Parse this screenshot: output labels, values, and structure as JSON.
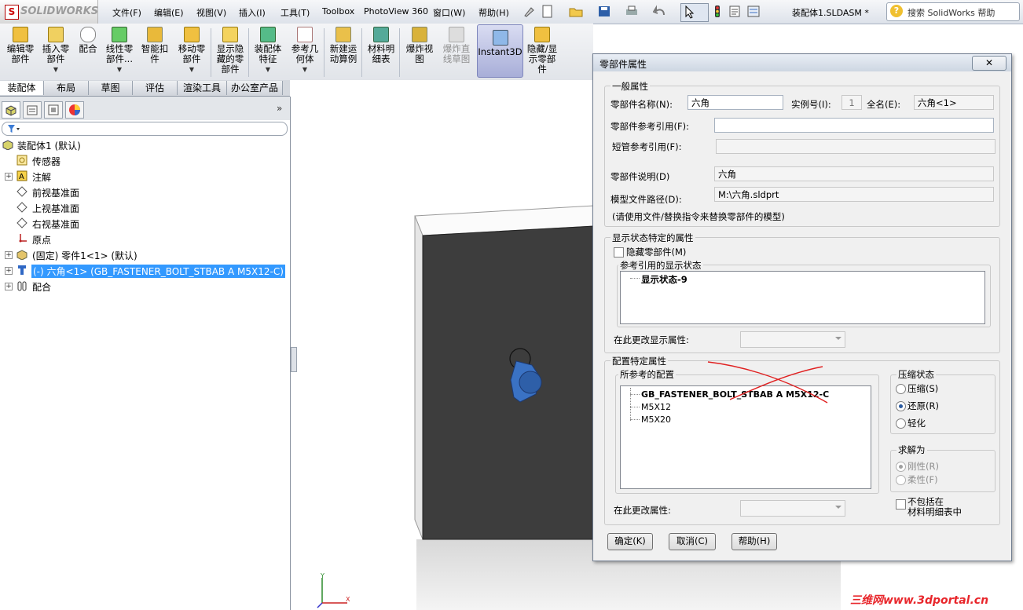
{
  "app": {
    "logo_text": "SOLIDWORKS",
    "document_title": "装配体1.SLDASM *"
  },
  "menu": [
    "文件(F)",
    "编辑(E)",
    "视图(V)",
    "插入(I)",
    "工具(T)",
    "Toolbox",
    "PhotoView 360",
    "窗口(W)",
    "帮助(H)"
  ],
  "search": {
    "placeholder": "搜索 SolidWorks 帮助"
  },
  "commands": [
    {
      "label": "编辑零\n部件"
    },
    {
      "label": "插入零\n部件"
    },
    {
      "label": "配合"
    },
    {
      "label": "线性零\n部件..."
    },
    {
      "label": "智能扣\n件"
    },
    {
      "label": "移动零\n部件"
    },
    {
      "label": "显示隐\n藏的零\n部件"
    },
    {
      "label": "装配体\n特征"
    },
    {
      "label": "参考几\n何体"
    },
    {
      "label": "新建运\n动算例"
    },
    {
      "label": "材料明\n细表"
    },
    {
      "label": "爆炸视\n图"
    },
    {
      "label": "爆炸直\n线草图"
    },
    {
      "label": "Instant3D"
    },
    {
      "label": "隐藏/显\n示零部\n件"
    }
  ],
  "tabs": [
    "装配体",
    "布局",
    "草图",
    "评估",
    "渲染工具",
    "办公室产品"
  ],
  "tree": {
    "root": "装配体1  (默认)",
    "items": [
      "传感器",
      "注解",
      "前视基准面",
      "上视基准面",
      "右视基准面",
      "原点",
      "(固定) 零件1<1> (默认)",
      "(-) 六角<1> (GB_FASTENER_BOLT_STBAB A M5X12-C)",
      "配合"
    ]
  },
  "dialog": {
    "title": "零部件属性",
    "close": "✕",
    "general": {
      "group": "一般属性",
      "name_label": "零部件名称(N):",
      "name_value": "六角",
      "instance_label": "实例号(I):",
      "instance_value": "1",
      "fullname_label": "全名(E):",
      "fullname_value": "六角<1>",
      "ref_label": "零部件参考引用(F):",
      "ref_value": "",
      "pipe_label": "短管参考引用(F):",
      "pipe_value": "",
      "desc_label": "零部件说明(D)",
      "desc_value": "六角",
      "path_label": "模型文件路径(D):",
      "path_value": "M:\\六角.sldprt",
      "note": "(请使用文件/替换指令来替换零部件的模型)"
    },
    "display": {
      "group": "显示状态特定的属性",
      "hide_label": "隐藏零部件(M)",
      "refstates_label": "参考引用的显示状态",
      "states": [
        "显示状态-9"
      ],
      "change_label": "在此更改显示属性:"
    },
    "config": {
      "group": "配置特定属性",
      "ref_label": "所参考的配置",
      "configs": [
        "GB_FASTENER_BOLT_STBAB A M5X12-C",
        "M5X12",
        "M5X20"
      ],
      "suppress": {
        "group": "压缩状态",
        "options": [
          "压缩(S)",
          "还原(R)",
          "轻化"
        ],
        "selected": 1
      },
      "solve": {
        "group": "求解为",
        "options": [
          "刚性(R)",
          "柔性(F)"
        ],
        "selected": 0
      },
      "exclude_bom": "不包括在\n材料明细表中",
      "change_label": "在此更改属性:"
    },
    "buttons": {
      "ok": "确定(K)",
      "cancel": "取消(C)",
      "help": "帮助(H)"
    }
  },
  "watermark": "三维网www.3dportal.cn",
  "colors": {
    "highlight": "#3399ff",
    "part_blue": "#3a72c4",
    "plate": "#3d3d3d",
    "annotation_red": "#e02020"
  }
}
